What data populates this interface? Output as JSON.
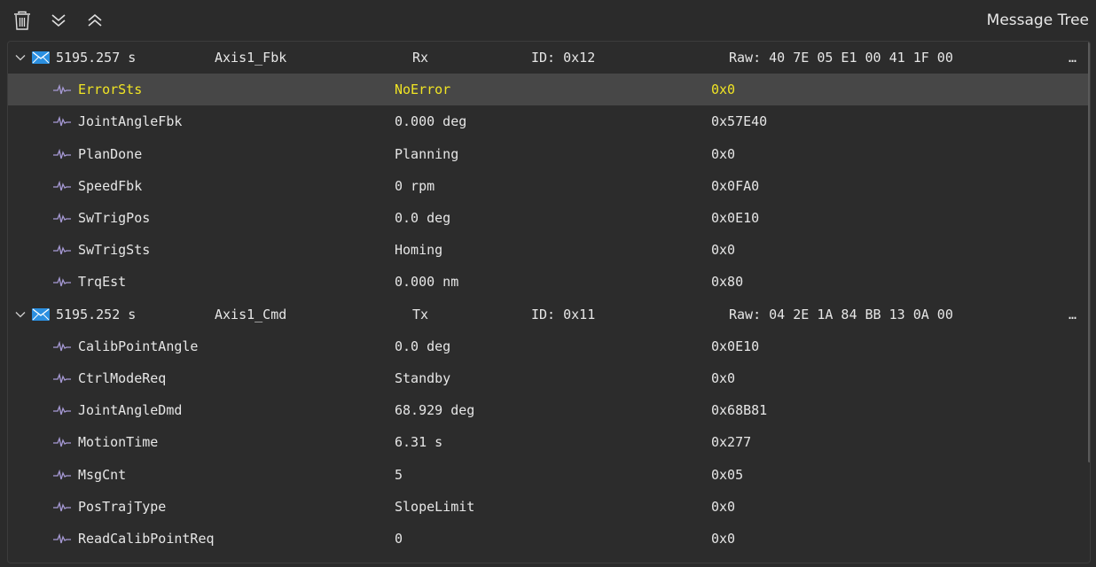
{
  "toolbar": {
    "title": "Message Tree",
    "buttons": [
      {
        "name": "trash-icon"
      },
      {
        "name": "collapse-down-icon"
      },
      {
        "name": "collapse-up-icon"
      }
    ]
  },
  "colors": {
    "background": "#2b2b2b",
    "selected_row": "#474747",
    "selected_text": "#f0e424",
    "mail_icon": "#2b8fe0",
    "wave_icon": "#a79ad6"
  },
  "messages": [
    {
      "time": "5195.257 s",
      "name": "Axis1_Fbk",
      "dir": "Rx",
      "id": "ID: 0x12",
      "raw": "Raw: 40 7E 05 E1 00 41 1F 00",
      "more": "…",
      "signals": [
        {
          "name": "ErrorSts",
          "value": "NoError",
          "raw": "0x0",
          "selected": true
        },
        {
          "name": "JointAngleFbk",
          "value": "0.000 deg",
          "raw": "0x57E40"
        },
        {
          "name": "PlanDone",
          "value": "Planning",
          "raw": "0x0"
        },
        {
          "name": "SpeedFbk",
          "value": "0 rpm",
          "raw": "0x0FA0"
        },
        {
          "name": "SwTrigPos",
          "value": "0.0 deg",
          "raw": "0x0E10"
        },
        {
          "name": "SwTrigSts",
          "value": "Homing",
          "raw": "0x0"
        },
        {
          "name": "TrqEst",
          "value": "0.000 nm",
          "raw": "0x80"
        }
      ]
    },
    {
      "time": "5195.252 s",
      "name": "Axis1_Cmd",
      "dir": "Tx",
      "id": "ID: 0x11",
      "raw": "Raw: 04 2E 1A 84 BB 13 0A 00",
      "more": "…",
      "signals": [
        {
          "name": "CalibPointAngle",
          "value": "0.0 deg",
          "raw": "0x0E10"
        },
        {
          "name": "CtrlModeReq",
          "value": "Standby",
          "raw": "0x0"
        },
        {
          "name": "JointAngleDmd",
          "value": "68.929 deg",
          "raw": "0x68B81"
        },
        {
          "name": "MotionTime",
          "value": "6.31 s",
          "raw": "0x277"
        },
        {
          "name": "MsgCnt",
          "value": "5",
          "raw": "0x05"
        },
        {
          "name": "PosTrajType",
          "value": "SlopeLimit",
          "raw": "0x0"
        },
        {
          "name": "ReadCalibPointReq",
          "value": "0",
          "raw": "0x0"
        }
      ]
    }
  ]
}
